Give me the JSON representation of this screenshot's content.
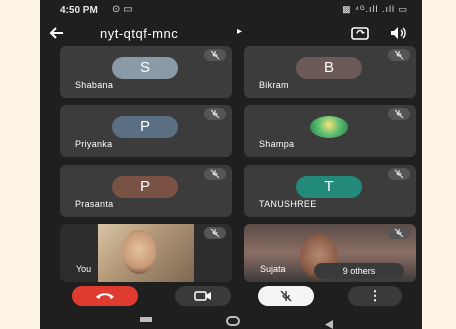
{
  "status": {
    "time": "4:50 PM",
    "notif_icons": "⊙ ▭",
    "right_icons": "▩ ⁴ᴳ.ıll .ıll ▭"
  },
  "header": {
    "title": "nyt-qtqf-mnc",
    "title_caret": "▸"
  },
  "participants": [
    {
      "name": "Shabana",
      "initial": "S",
      "color": "#8a9aa6",
      "muted": true
    },
    {
      "name": "Bikram",
      "initial": "B",
      "color": "#6b5a55",
      "muted": true
    },
    {
      "name": "Priyanka",
      "initial": "P",
      "color": "#5a6f82",
      "muted": true
    },
    {
      "name": "Shampa",
      "initial": "",
      "color": "#2f9a6a",
      "muted": true
    },
    {
      "name": "Prasanta",
      "initial": "P",
      "color": "#7a5245",
      "muted": true
    },
    {
      "name": "TANUSHREE",
      "initial": "T",
      "color": "#23897a",
      "muted": true
    }
  ],
  "videos": {
    "you_label": "You",
    "sujata_label": "Sujata",
    "others_label": "9 others"
  },
  "colors": {
    "end_call": "#e03b30",
    "background": "#1f1f1f",
    "tile": "#3c3c3c"
  },
  "controls": {
    "more_label": "⋮"
  }
}
